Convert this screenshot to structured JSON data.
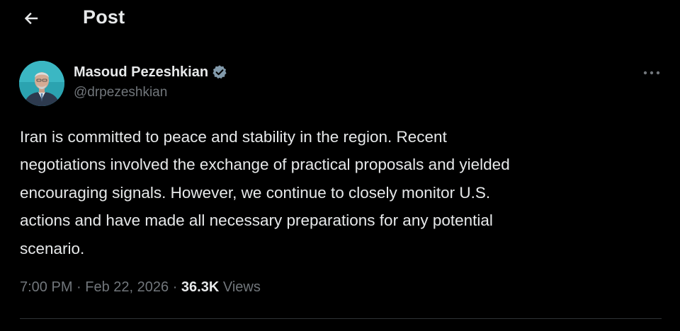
{
  "header": {
    "title": "Post",
    "back_icon": "arrow-left-icon"
  },
  "author": {
    "display_name": "Masoud Pezeshkian",
    "handle": "@drpezeshkian",
    "verified_icon": "verified-badge-icon",
    "verified_color": "#829aab"
  },
  "post": {
    "text": "Iran is committed to peace and stability in the region. Recent\nnegotiations involved the exchange of practical proposals and yielded\nencouraging signals. However, we continue to closely monitor U.S.\nactions and have made all necessary preparations for any potential\nscenario."
  },
  "meta": {
    "time": "7:00 PM",
    "separator": " · ",
    "date": "Feb 22, 2026",
    "views_count": "36.3K",
    "views_label": " Views"
  },
  "more_icon": "more-horizontal-icon",
  "colors": {
    "background": "#000000",
    "primary_text": "#e7e9ea",
    "secondary_text": "#71767b",
    "divider": "#2f3336"
  }
}
